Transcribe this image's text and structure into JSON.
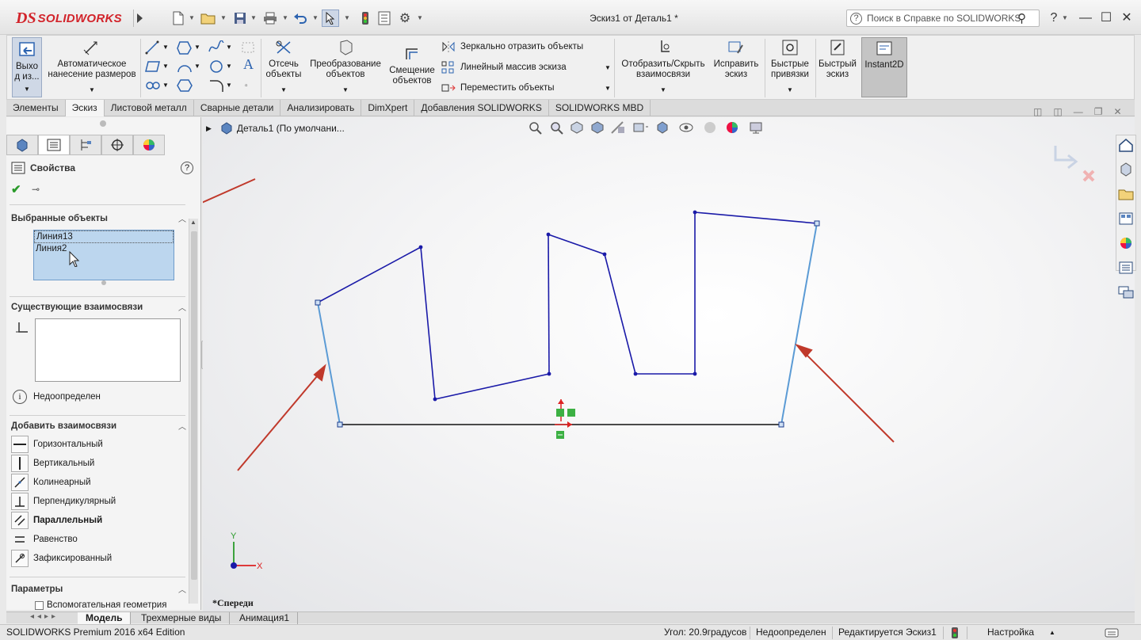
{
  "titlebar": {
    "logo_ds": "DS",
    "logo_text": "SOLIDWORKS",
    "document_title": "Эскиз1 от Деталь1 *",
    "help_search_placeholder": "Поиск в Справке по SOLIDWORKS",
    "help_label": "?"
  },
  "ribbon": {
    "exit_sketch": [
      "Выхо",
      "д из..."
    ],
    "smart_dimension": [
      "Автоматическое",
      "нанесение размеров"
    ],
    "trim": [
      "Отсечь",
      "объекты"
    ],
    "convert": [
      "Преобразование",
      "объектов"
    ],
    "offset": [
      "Смещение",
      "объектов"
    ],
    "mirror": "Зеркально отразить объекты",
    "linear_pattern": "Линейный массив эскиза",
    "move": "Переместить объекты",
    "display_relations": [
      "Отобразить/Скрыть",
      "взаимосвязи"
    ],
    "repair": [
      "Исправить",
      "эскиз"
    ],
    "quick_snaps": [
      "Быстрые",
      "привязки"
    ],
    "rapid_sketch": [
      "Быстрый",
      "эскиз"
    ],
    "instant2d": "Instant2D"
  },
  "tabs": [
    "Элементы",
    "Эскиз",
    "Листовой металл",
    "Сварные детали",
    "Анализировать",
    "DimXpert",
    "Добавления SOLIDWORKS",
    "SOLIDWORKS MBD"
  ],
  "active_tab": "Эскиз",
  "property_manager": {
    "title": "Свойства",
    "selected_header": "Выбранные объекты",
    "selected_items": [
      "Линия13",
      "Линия2"
    ],
    "existing_header": "Существующие взаимосвязи",
    "status_text": "Недоопределен",
    "add_header": "Добавить взаимосвязи",
    "relations": [
      "Горизонтальный",
      "Вертикальный",
      "Колинеарный",
      "Перпендикулярный",
      "Параллельный",
      "Равенство",
      "Зафиксированный"
    ],
    "params_header": "Параметры",
    "construction": "Вспомогательная геометрия"
  },
  "viewport": {
    "tree_root": "Деталь1  (По умолчани...",
    "view_name": "*Спереди",
    "axis_x": "X",
    "axis_y": "Y"
  },
  "bottom_tabs": [
    "Модель",
    "Трехмерные виды",
    "Анимация1"
  ],
  "status": {
    "edition": "SOLIDWORKS Premium 2016 x64 Edition",
    "angle": "Угол: 20.9градусов",
    "defined": "Недоопределен",
    "editing": "Редактируется Эскиз1",
    "custom": "Настройка"
  },
  "colors": {
    "selected_line": "#5b9bd5",
    "sketch_line": "#1a1aa8",
    "annotation_arrow": "#c0392b",
    "brand_red": "#d2232a"
  }
}
